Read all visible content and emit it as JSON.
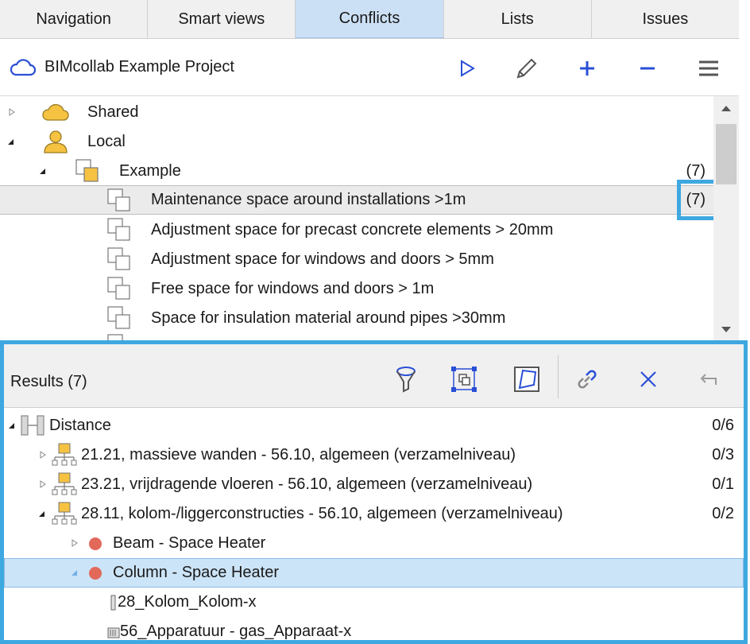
{
  "tabs": [
    "Navigation",
    "Smart views",
    "Conflicts",
    "Lists",
    "Issues"
  ],
  "active_tab": "Conflicts",
  "project": {
    "title": "BIMcollab Example Project"
  },
  "tree": {
    "shared": "Shared",
    "local": "Local",
    "group": {
      "label": "Example",
      "count": "(7)"
    },
    "rules": [
      {
        "label": "Maintenance space around installations >1m",
        "count": "(7)"
      },
      {
        "label": "Adjustment space for precast concrete elements > 20mm"
      },
      {
        "label": "Adjustment space for windows and doors > 5mm"
      },
      {
        "label": "Free space for windows and doors > 1m"
      },
      {
        "label": "Space for insulation material around pipes >30mm"
      }
    ]
  },
  "results": {
    "title": "Results (7)",
    "rows": [
      {
        "label": "Distance",
        "count": "0/6"
      },
      {
        "label": "21.21, massieve wanden - 56.10, algemeen (verzamelniveau)",
        "count": "0/3"
      },
      {
        "label": "23.21, vrijdragende vloeren - 56.10, algemeen (verzamelniveau)",
        "count": "0/1"
      },
      {
        "label": "28.11, kolom-/liggerconstructies - 56.10, algemeen (verzamelniveau)",
        "count": "0/2"
      },
      {
        "label": "Beam - Space Heater"
      },
      {
        "label": "Column - Space Heater"
      },
      {
        "label": "28_Kolom_Kolom-x"
      },
      {
        "label": "56_Apparatuur - gas_Apparaat-x"
      }
    ]
  },
  "colors": {
    "accent": "#2a4fd6",
    "highlight": "#3ea8e0",
    "selected": "#cce4f7",
    "clash": "#e2685a",
    "folder": "#f5c242"
  }
}
